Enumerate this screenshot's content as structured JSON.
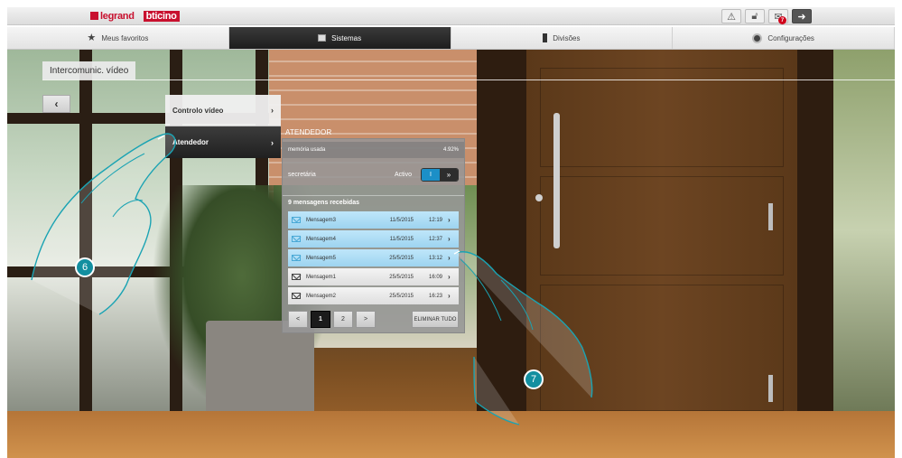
{
  "header": {
    "brand_left": "legrand",
    "brand_right": "bticino",
    "icons": [
      "alert-icon",
      "lock-icon",
      "mail-icon",
      "logout-icon"
    ],
    "mail_badge": "7"
  },
  "nav": {
    "tabs": [
      {
        "label": "Meus favoritos",
        "icon": "star-icon",
        "active": false
      },
      {
        "label": "Sistemas",
        "icon": "systems-icon",
        "active": true
      },
      {
        "label": "Divisões",
        "icon": "door-icon",
        "active": false
      },
      {
        "label": "Configurações",
        "icon": "gear-icon",
        "active": false
      }
    ]
  },
  "page": {
    "title": "Intercomunic. vídeo",
    "back_label": "‹"
  },
  "menu": {
    "items": [
      {
        "label": "Controlo vídeo",
        "chevron": "›"
      },
      {
        "label": "Atendedor",
        "chevron": "›"
      }
    ]
  },
  "answering": {
    "section_title": "ATENDEDOR",
    "memory_label": "memória usada",
    "memory_value": "4.92%",
    "secretary_label": "secretária",
    "secretary_status": "Activo",
    "toggle_on": "I",
    "toggle_arrow": "»",
    "received_label": "9 mensagens recebidas",
    "messages": [
      {
        "name": "Mensagem3",
        "date": "11/5/2015",
        "time": "12:19",
        "go": "›"
      },
      {
        "name": "Mensagem4",
        "date": "11/5/2015",
        "time": "12:37",
        "go": "›"
      },
      {
        "name": "Mensagem5",
        "date": "25/5/2015",
        "time": "13:12",
        "go": "›"
      },
      {
        "name": "Mensagem1",
        "date": "25/5/2015",
        "time": "16:09",
        "go": "›"
      },
      {
        "name": "Mensagem2",
        "date": "25/5/2015",
        "time": "16:23",
        "go": "›"
      }
    ],
    "pager": {
      "prev": "<",
      "page1": "1",
      "page2": "2",
      "next": ">"
    },
    "delete_all": "ELIMINAR TUDO"
  },
  "steps": {
    "first": "6",
    "second": "7"
  },
  "colors": {
    "accent_blue": "#1c8fc7",
    "step_teal": "#138fa0",
    "unread": "#9dd4f0",
    "legrand_red": "#c8102e"
  }
}
